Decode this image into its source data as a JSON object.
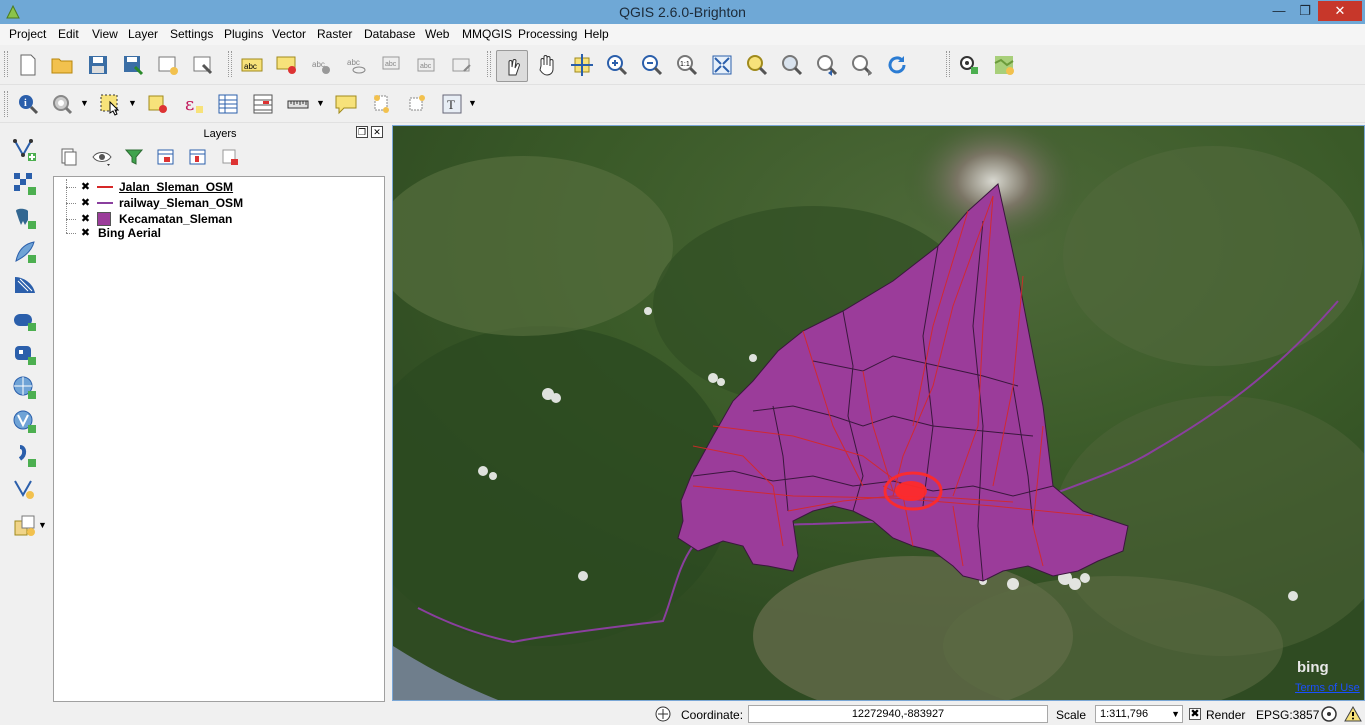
{
  "window": {
    "title": "QGIS 2.6.0-Brighton"
  },
  "menu": [
    "Project",
    "Edit",
    "View",
    "Layer",
    "Settings",
    "Plugins",
    "Vector",
    "Raster",
    "Database",
    "Web",
    "MMQGIS",
    "Processing",
    "Help"
  ],
  "layers_panel": {
    "title": "Layers",
    "layers": [
      {
        "name": "Jalan_Sleman_OSM",
        "checked": true,
        "type": "line",
        "color": "#d62828"
      },
      {
        "name": "railway_Sleman_OSM",
        "checked": true,
        "type": "line",
        "color": "#8a3f9e"
      },
      {
        "name": "Kecamatan_Sleman",
        "checked": true,
        "type": "polygon",
        "color": "#9b3c9a"
      },
      {
        "name": "Bing Aerial",
        "checked": true,
        "type": "raster"
      }
    ]
  },
  "map": {
    "attribution_logo": "bing",
    "terms_link": "Terms of Use"
  },
  "statusbar": {
    "coordinate_label": "Coordinate:",
    "coordinate_value": "12272940,-883927",
    "scale_label": "Scale",
    "scale_value": "1:311,796",
    "render_label": "Render",
    "render_checked": true,
    "crs": "EPSG:3857"
  },
  "colors": {
    "titlebar": "#6fa8d6",
    "close_button": "#c7372a",
    "polygon_fill": "#9b3c9a",
    "roads": "#d62828",
    "railway": "#8a3f9e"
  }
}
